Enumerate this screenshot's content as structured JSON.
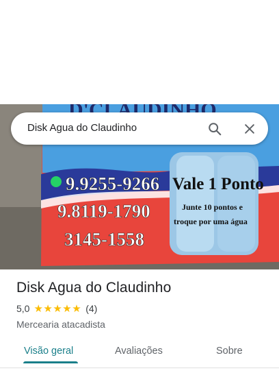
{
  "search": {
    "query": "Disk Agua do Claudinho"
  },
  "photo": {
    "card_phones": [
      "9.9255-9266",
      "9.8119-1790",
      "3145-1558"
    ],
    "card_promo_title": "Vale 1 Ponto",
    "card_promo_line1": "Junte 10 pontos e",
    "card_promo_line2": "troque por uma água"
  },
  "place": {
    "title": "Disk Agua do Claudinho",
    "rating": "5,0",
    "stars": "★★★★★",
    "reviews_count": "(4)",
    "category": "Mercearia atacadista"
  },
  "tabs": [
    {
      "label": "Visão geral",
      "active": true
    },
    {
      "label": "Avaliações",
      "active": false
    },
    {
      "label": "Sobre",
      "active": false
    }
  ],
  "colors": {
    "accent": "#1a7f8a",
    "star": "#fbbc04"
  }
}
